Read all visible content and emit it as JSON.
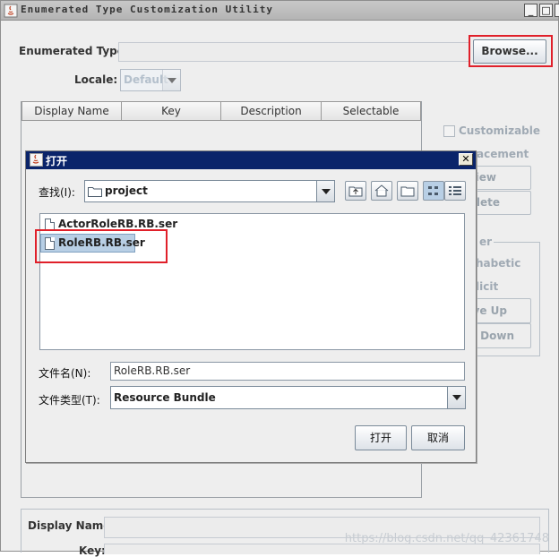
{
  "window": {
    "title": "Enumerated Type Customization Utility",
    "minimize": "_",
    "maximize": "□",
    "close": "✕"
  },
  "main": {
    "enum_label": "Enumerated Type:",
    "enum_value": "",
    "browse_label": "Browse...",
    "locale_label": "Locale:",
    "locale_value": "Default",
    "columns": [
      "Display Name",
      "Key",
      "Description",
      "Selectable"
    ],
    "customizable_label": "Customizable",
    "replacement_label": "acement",
    "new_label": "iew",
    "delete_label": "elete",
    "order_label": "er",
    "alphabetic_label": "habetic",
    "explicit_label": "licit",
    "move_up_label": "ve Up",
    "move_down_label": "e Down",
    "display_name_label": "Display Name:",
    "key_label": "Key:"
  },
  "dialog": {
    "title": "打开",
    "close": "✕",
    "look_in_label": "查找(I):",
    "look_in_value": "project",
    "files": [
      "ActorRoleRB.RB.ser",
      "RoleRB.RB.ser"
    ],
    "selected_file": "RoleRB.RB.ser",
    "filename_label": "文件名(N):",
    "filename_value": "RoleRB.RB.ser",
    "filetype_label": "文件类型(T):",
    "filetype_value": "Resource Bundle",
    "open_label": "打开",
    "cancel_label": "取消"
  },
  "watermark": "https://blog.csdn.net/qq_42361748",
  "colors": {
    "highlight": "#e0202a",
    "dialog_title_bg": "#0a246a",
    "selection_bg": "#b8cfe5"
  }
}
